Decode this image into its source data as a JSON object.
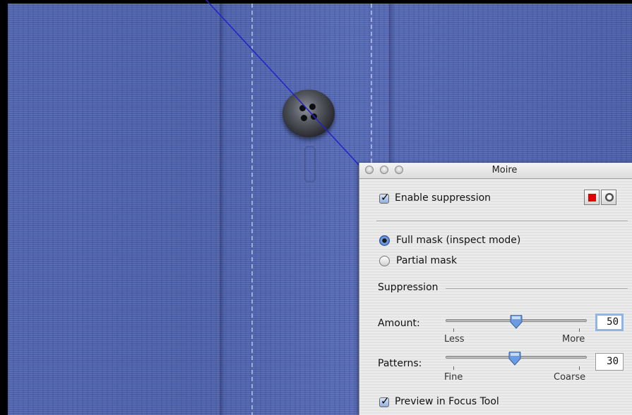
{
  "window": {
    "title": "Moire"
  },
  "options": {
    "enable_suppression": {
      "label": "Enable suppression",
      "checked": true
    },
    "mask_mode": {
      "selected": "full",
      "full_label": "Full mask (inspect mode)",
      "partial_label": "Partial mask"
    }
  },
  "mode_buttons": {
    "red_icon": "red-square-icon",
    "circle_icon": "circle-mask-icon"
  },
  "suppression": {
    "group_label": "Suppression",
    "amount": {
      "label": "Amount:",
      "value": "50",
      "min_label": "Less",
      "max_label": "More",
      "level": 0.5
    },
    "patterns": {
      "label": "Patterns:",
      "value": "30",
      "min_label": "Fine",
      "max_label": "Coarse",
      "level": 0.5
    }
  },
  "preview": {
    "label": "Preview in Focus Tool",
    "checked": true
  },
  "colors": {
    "fabric": "#4f63ad",
    "arrow": "#2222cc",
    "checkbox_accent": "#2e62c8",
    "red_button": "#e00000"
  }
}
